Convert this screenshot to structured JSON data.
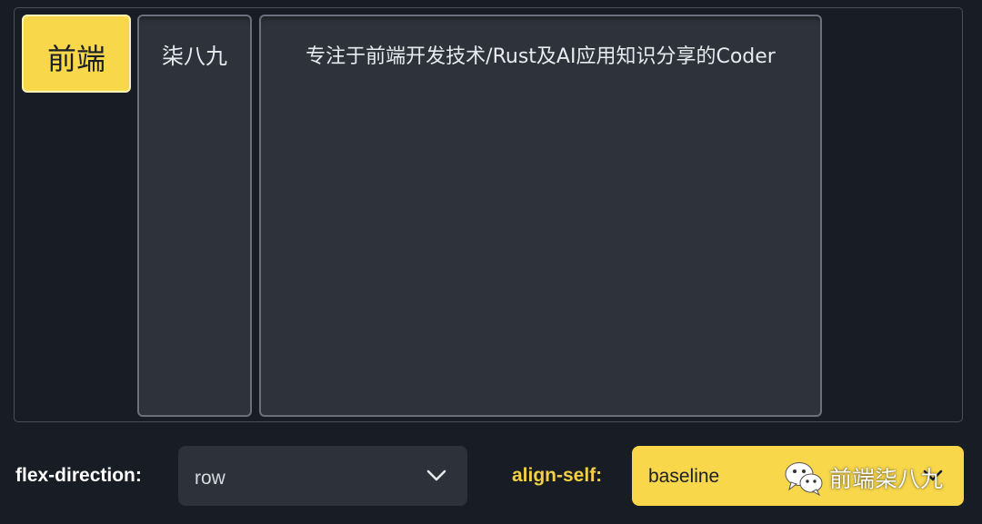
{
  "demo": {
    "items": [
      {
        "label": "前端"
      },
      {
        "label": "柒八九"
      },
      {
        "label": "专注于前端开发技术/Rust及AI应用知识分享的Coder"
      }
    ]
  },
  "controls": {
    "flex_direction": {
      "label": "flex-direction:",
      "value": "row",
      "icon": "chevron-down-icon"
    },
    "align_self": {
      "label": "align-self:",
      "value": "baseline",
      "icon": "chevron-down-icon"
    }
  },
  "watermark": {
    "icon": "wechat-icon",
    "text": "前端柒八九"
  },
  "colors": {
    "background": "#171c25",
    "accent_yellow": "#f8d74a",
    "item_gray": "#2e333b",
    "item_border": "#6b717c"
  }
}
